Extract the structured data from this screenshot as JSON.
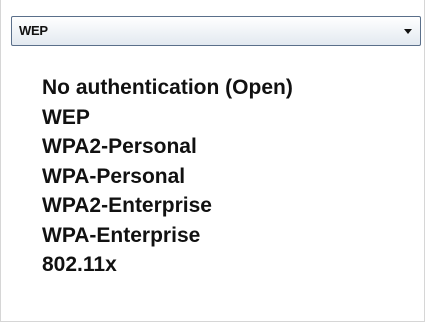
{
  "select": {
    "value": "WEP"
  },
  "options": [
    {
      "label": "No authentication (Open)"
    },
    {
      "label": "WEP"
    },
    {
      "label": "WPA2-Personal"
    },
    {
      "label": "WPA-Personal"
    },
    {
      "label": "WPA2-Enterprise"
    },
    {
      "label": "WPA-Enterprise"
    },
    {
      "label": "802.11x"
    }
  ],
  "icons": {
    "select_arrow": "chevron-down-icon"
  }
}
